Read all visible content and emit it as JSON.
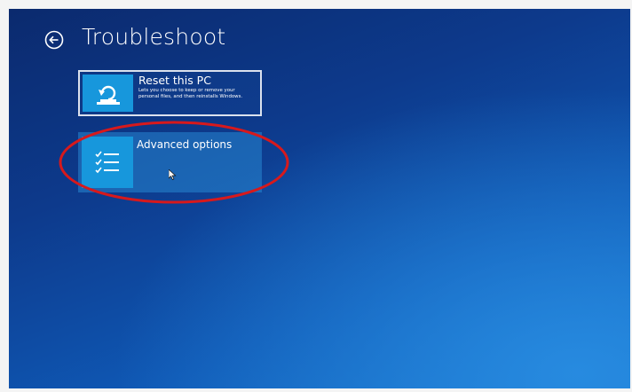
{
  "header": {
    "back_icon": "back-arrow-circle-icon",
    "title": "Troubleshoot"
  },
  "tiles": [
    {
      "icon": "reset-pc-icon",
      "title": "Reset this PC",
      "description": "Lets you choose to keep or remove your personal files, and then reinstalls Windows."
    },
    {
      "icon": "checklist-icon",
      "title": "Advanced options"
    }
  ],
  "annotation": {
    "shape": "ellipse",
    "color": "#d7191c"
  },
  "colors": {
    "background_dark": "#0b2a6e",
    "background_light": "#1672cc",
    "tile_icon": "#1797dc"
  }
}
